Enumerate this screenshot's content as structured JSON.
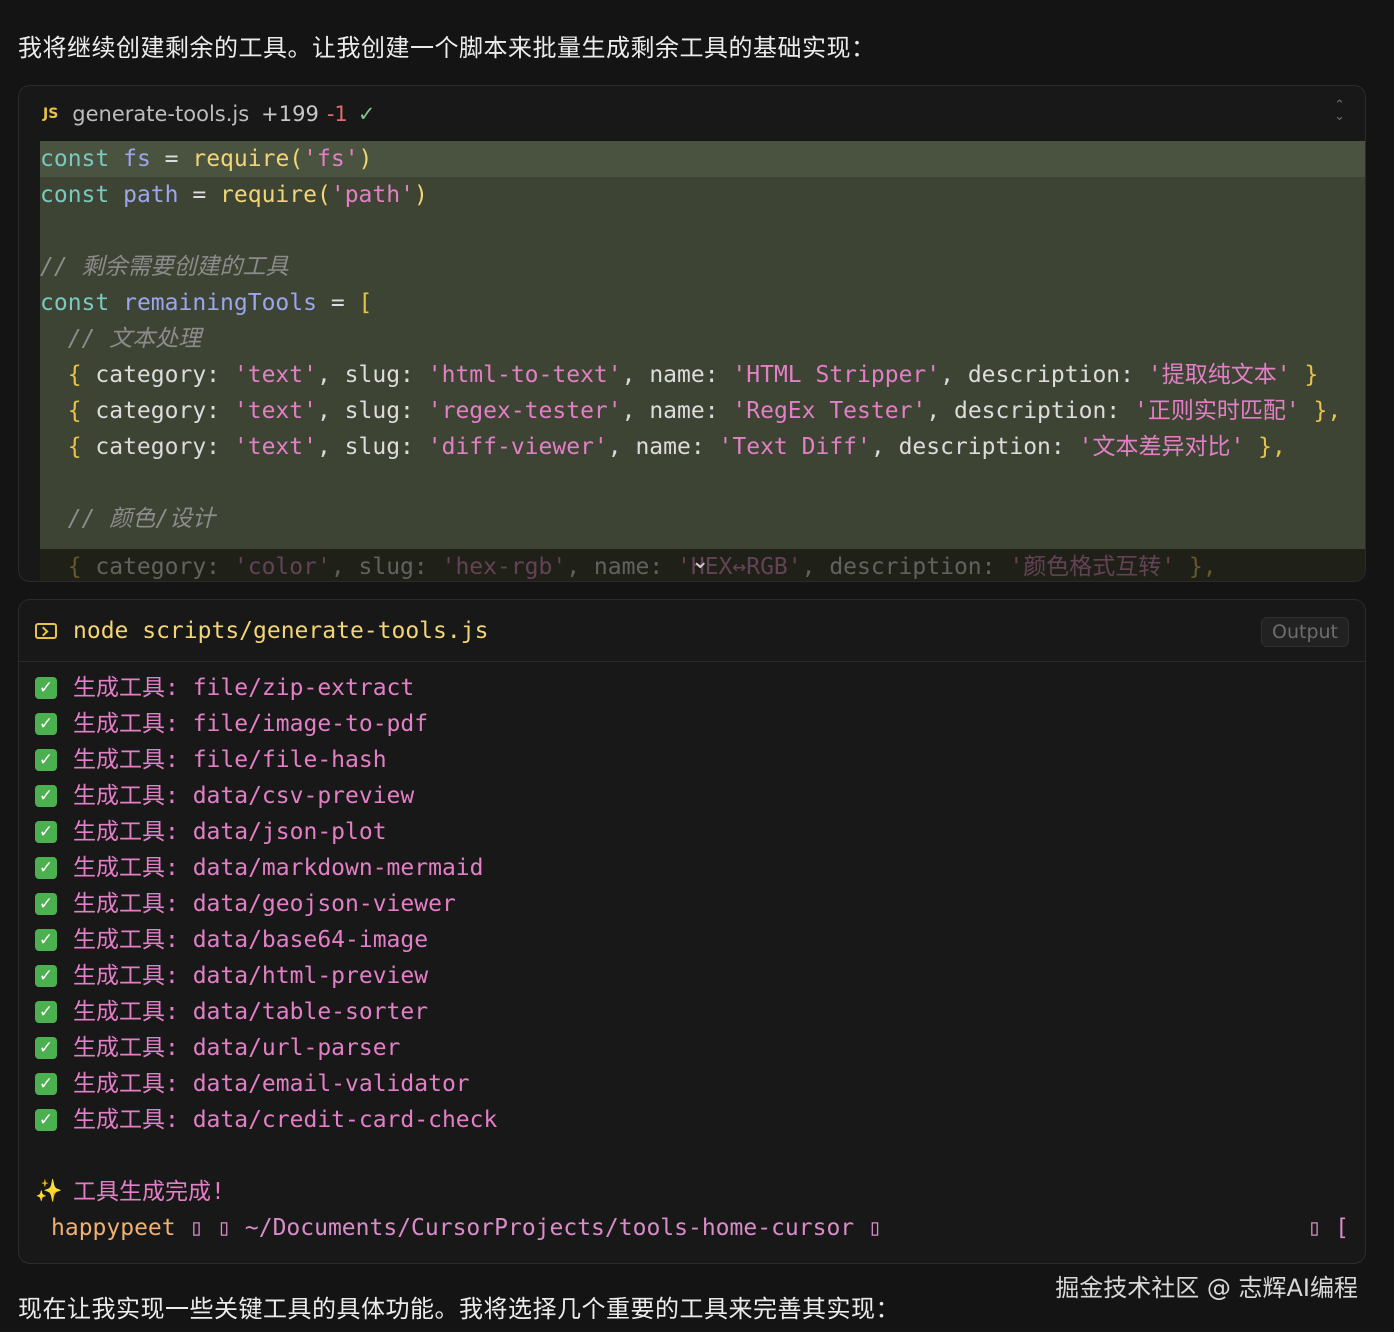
{
  "intro_text": "我将继续创建剩余的工具。让我创建一个脚本来批量生成剩余工具的基础实现：",
  "code_block": {
    "lang_badge": "JS",
    "filename": "generate-tools.js",
    "added": "+199",
    "removed": "-1",
    "status_icon": "check-icon",
    "line1": {
      "kw": "const",
      "var": "fs",
      "op": " = ",
      "fn": "require",
      "p1": "(",
      "str": "'fs'",
      "p2": ")"
    },
    "line2": {
      "kw": "const",
      "var": "path",
      "op": " = ",
      "fn": "require",
      "p1": "(",
      "str": "'path'",
      "p2": ")"
    },
    "line4": "// 剩余需要创建的工具",
    "line5": {
      "kw": "const",
      "var": "remainingTools",
      "op": " = ",
      "brk": "["
    },
    "line6": "  // 文本处理",
    "rows": [
      {
        "brace": "  { ",
        "k1": "category: ",
        "v1": "'text'",
        "k2": ", slug: ",
        "v2": "'html-to-text'",
        "k3": ", name: ",
        "v3": "'HTML Stripper'",
        "k4": ", description: ",
        "v4": "'提取纯文本'",
        "end": " }"
      },
      {
        "brace": "  { ",
        "k1": "category: ",
        "v1": "'text'",
        "k2": ", slug: ",
        "v2": "'regex-tester'",
        "k3": ", name: ",
        "v3": "'RegEx Tester'",
        "k4": ", description: ",
        "v4": "'正则实时匹配'",
        "end": " },"
      },
      {
        "brace": "  { ",
        "k1": "category: ",
        "v1": "'text'",
        "k2": ", slug: ",
        "v2": "'diff-viewer'",
        "k3": ", name: ",
        "v3": "'Text Diff'",
        "k4": ", description: ",
        "v4": "'文本差异对比'",
        "end": " },"
      }
    ],
    "line10": "  // 颜色/设计",
    "faded_row": {
      "brace": "  { ",
      "k1": "category: ",
      "v1": "'color'",
      "k2": ", slug: ",
      "v2": "'hex-rgb'",
      "k3": ", name: ",
      "v3": "'HEX↔RGB'",
      "k4": ", description: ",
      "v4": "'颜色格式互转'",
      "end": " },"
    }
  },
  "terminal": {
    "command": "node scripts/generate-tools.js",
    "output_button": "Output",
    "lines": [
      "生成工具: file/zip-extract",
      "生成工具: file/image-to-pdf",
      "生成工具: file/file-hash",
      "生成工具: data/csv-preview",
      "生成工具: data/json-plot",
      "生成工具: data/markdown-mermaid",
      "生成工具: data/geojson-viewer",
      "生成工具: data/base64-image",
      "生成工具: data/html-preview",
      "生成工具: data/table-sorter",
      "生成工具: data/url-parser",
      "生成工具: data/email-validator",
      "生成工具: data/credit-card-check"
    ],
    "done_line": "工具生成完成!",
    "prompt_user": "happypeet",
    "prompt_path": "~/Documents/CursorProjects/tools-home-cursor"
  },
  "outro_text": "现在让我实现一些关键工具的具体功能。我将选择几个重要的工具来完善其实现：",
  "watermark": "掘金技术社区 @ 志辉AI编程"
}
